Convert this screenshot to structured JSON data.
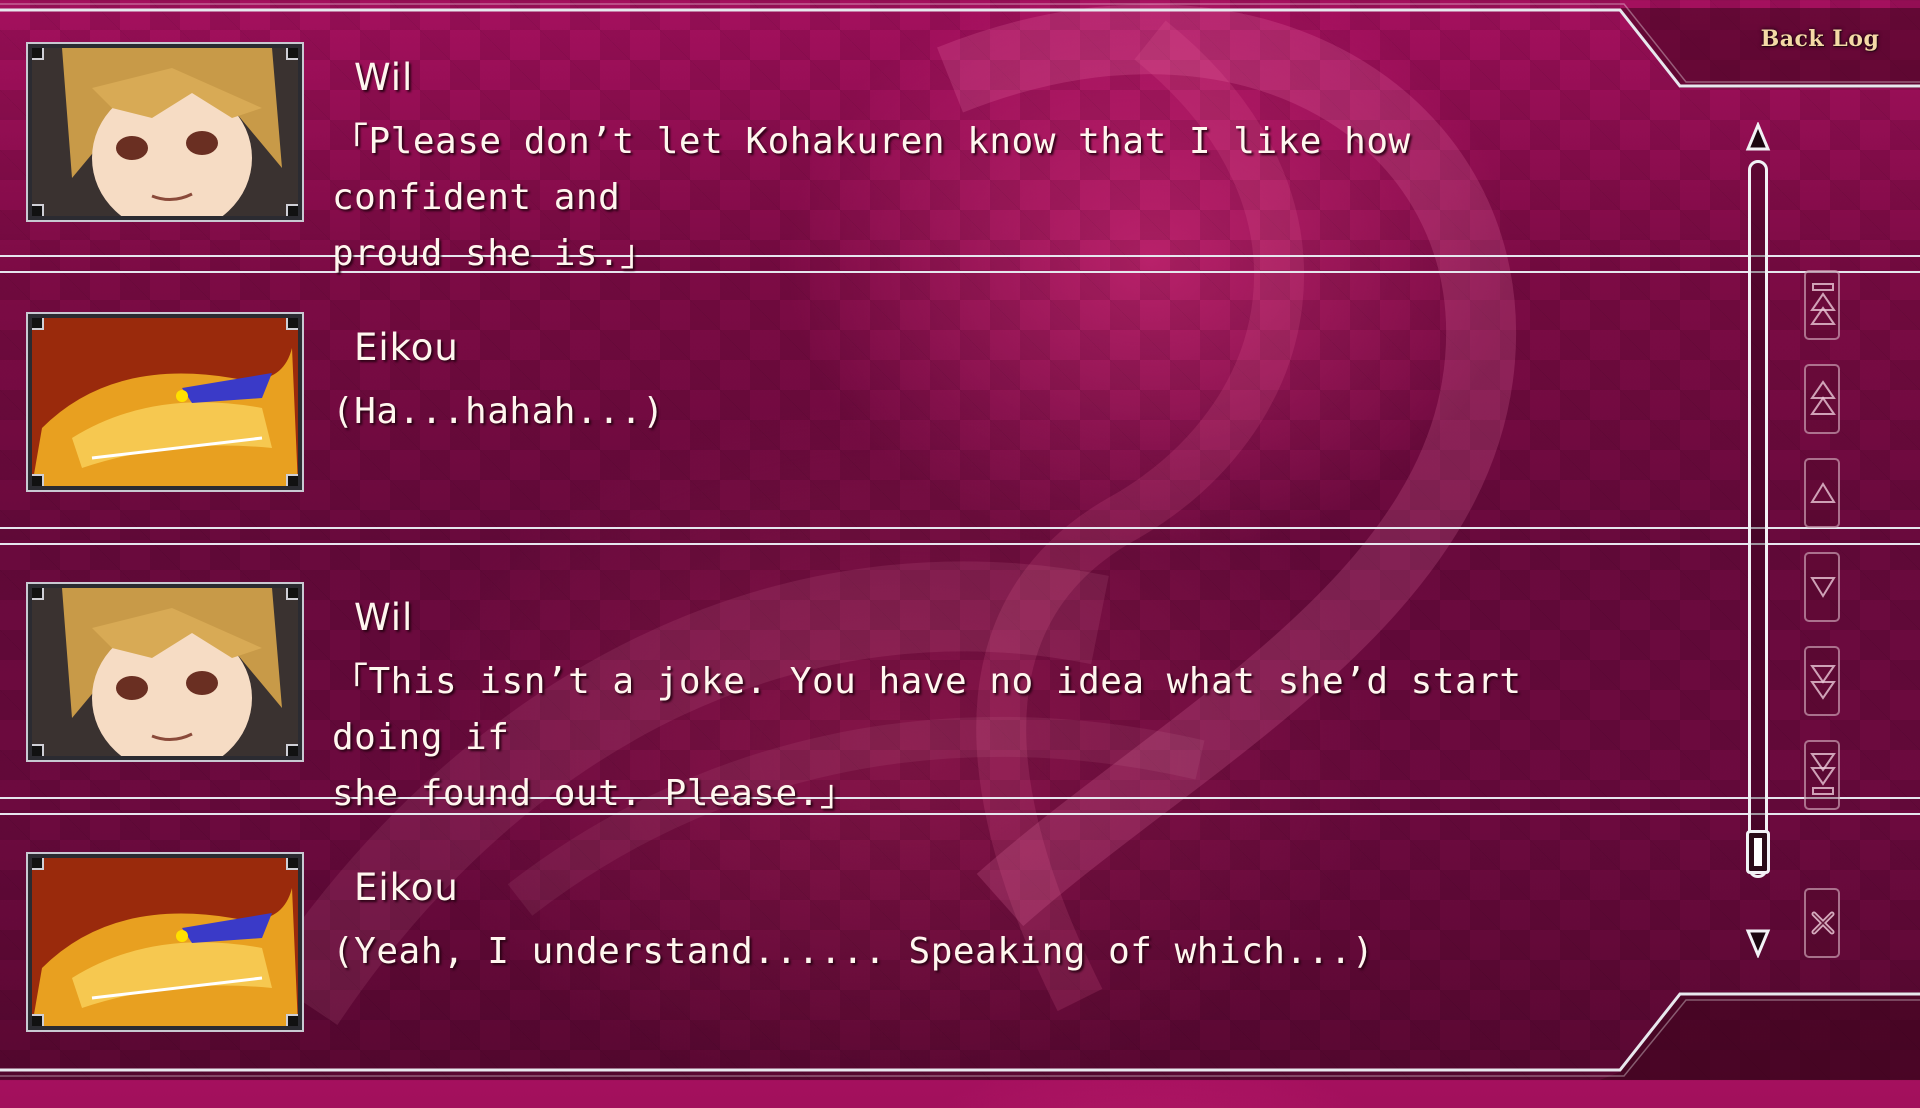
{
  "header": {
    "title": "Back Log"
  },
  "entries": [
    {
      "speaker": "Wil",
      "portrait_icon": "wil-portrait-icon",
      "lines": [
        "「Please don’t let Kohakuren know that I like how confident and",
        " proud she is.」"
      ]
    },
    {
      "speaker": "Eikou",
      "portrait_icon": "eikou-dragon-portrait-icon",
      "lines": [
        "(Ha...hahah...)"
      ]
    },
    {
      "speaker": "Wil",
      "portrait_icon": "wil-portrait-icon",
      "lines": [
        "「This isn’t a joke. You have no idea what she’d start doing if",
        " she found out. Please.」"
      ]
    },
    {
      "speaker": "Eikou",
      "portrait_icon": "eikou-dragon-portrait-icon",
      "lines": [
        "(Yeah, I understand...... Speaking of which...)"
      ]
    }
  ],
  "scrollbar": {
    "position": 1.0
  },
  "controls": [
    {
      "name": "scroll-to-top-button",
      "icon": "double-up-bar-icon"
    },
    {
      "name": "page-up-button",
      "icon": "double-up-icon"
    },
    {
      "name": "line-up-button",
      "icon": "up-icon"
    },
    {
      "name": "line-down-button",
      "icon": "down-icon"
    },
    {
      "name": "page-down-button",
      "icon": "double-down-icon"
    },
    {
      "name": "scroll-to-bottom-button",
      "icon": "double-down-bar-icon"
    },
    {
      "name": "close-button",
      "icon": "close-icon"
    }
  ],
  "colors": {
    "bg_top": "#a5105e",
    "bg_bottom": "#5a0832",
    "text": "#fff6ee",
    "title": "#f5d9a6"
  }
}
